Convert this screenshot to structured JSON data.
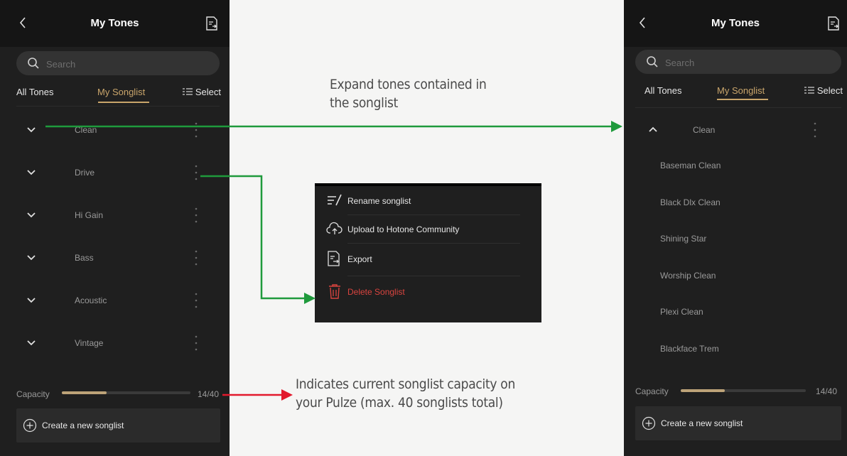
{
  "colors": {
    "accent": "#c9a56b",
    "danger": "#d9443f",
    "green_arrow": "#1f9a3c",
    "red_arrow": "#e2192c"
  },
  "left_screen": {
    "title": "My Tones",
    "search_placeholder": "Search",
    "tabs": {
      "all": "All Tones",
      "songlist": "My Songlist",
      "select": "Select"
    },
    "songlists": [
      {
        "name": "Clean",
        "expanded": false
      },
      {
        "name": "Drive",
        "expanded": false
      },
      {
        "name": "Hi Gain",
        "expanded": false
      },
      {
        "name": "Bass",
        "expanded": false
      },
      {
        "name": "Acoustic",
        "expanded": false
      },
      {
        "name": "Vintage",
        "expanded": false
      }
    ],
    "capacity_label": "Capacity",
    "capacity_value": "14/40",
    "capacity_fraction": 0.35,
    "create_label": "Create a new songlist"
  },
  "menu": {
    "items": [
      {
        "label": "Rename songlist",
        "icon": "rename-icon"
      },
      {
        "label": "Upload to Hotone Community",
        "icon": "cloud-upload-icon"
      },
      {
        "label": "Export",
        "icon": "export-icon"
      },
      {
        "label": "Delete Songlist",
        "icon": "trash-icon",
        "danger": true
      }
    ]
  },
  "right_screen": {
    "title": "My Tones",
    "search_placeholder": "Search",
    "tabs": {
      "all": "All Tones",
      "songlist": "My Songlist",
      "select": "Select"
    },
    "expanded_songlist": "Clean",
    "tones": [
      "Baseman Clean",
      "Black Dlx Clean",
      "Shining Star",
      "Worship Clean",
      "Plexi Clean",
      "Blackface Trem"
    ],
    "capacity_label": "Capacity",
    "capacity_value": "14/40",
    "capacity_fraction": 0.35,
    "create_label": "Create a new songlist"
  },
  "annotations": {
    "expand_line1": "Expand tones contained in",
    "expand_line2": "the songlist",
    "capacity_line1": "Indicates current songlist capacity on",
    "capacity_line2": "your Pulze (max. 40 songlists total)"
  }
}
